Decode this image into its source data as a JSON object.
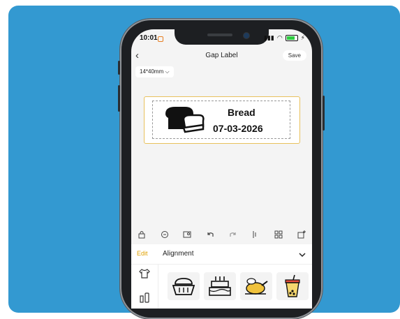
{
  "status": {
    "time": "10:01",
    "battery_pct": 0.7
  },
  "header": {
    "title": "Gap Label",
    "save_label": "Save"
  },
  "label_size": "14*40mm",
  "label": {
    "name": "Bread",
    "date": "07-03-2026"
  },
  "colors": {
    "background": "#3399d1",
    "accent": "#e0a100",
    "label_border": "#e8c15c"
  },
  "toolbar_icons": [
    "lock-icon",
    "format-icon",
    "image-edit-icon",
    "undo-icon",
    "redo-icon",
    "align-icon",
    "grid-icon",
    "add-frame-icon"
  ],
  "panel": {
    "tabs": [
      "Edit",
      "Alignment"
    ],
    "categories": [
      "clothing-icon",
      "cosmetics-icon"
    ],
    "tiles": [
      "bread-basket-icon",
      "birthday-cake-icon",
      "roast-chicken-icon",
      "bubble-tea-icon"
    ]
  }
}
